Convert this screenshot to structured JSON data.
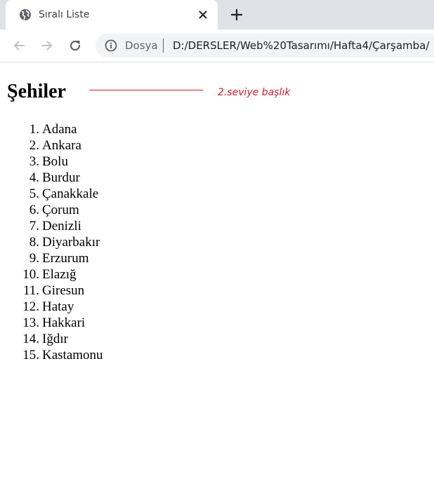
{
  "browser": {
    "tab": {
      "title": "Sıralı Liste",
      "favicon": "globe-icon",
      "close_icon": "close-icon"
    },
    "new_tab_icon": "plus-icon",
    "toolbar": {
      "back_icon": "arrow-left-icon",
      "forward_icon": "arrow-right-icon",
      "reload_icon": "reload-icon"
    },
    "omnibox": {
      "info_icon": "info-icon",
      "security_label": "Dosya",
      "url": "D:/DERSLER/Web%20Tasarımı/Hafta4/Çarşamba/"
    }
  },
  "page": {
    "heading": "Şehiler",
    "annotation": {
      "label": "2.seviye başlık",
      "color": "#cc1f2b"
    },
    "cities": [
      {
        "num": "1.",
        "name": "Adana"
      },
      {
        "num": "2.",
        "name": "Ankara"
      },
      {
        "num": "3.",
        "name": "Bolu"
      },
      {
        "num": "4.",
        "name": "Burdur"
      },
      {
        "num": "5.",
        "name": "Çanakkale"
      },
      {
        "num": "6.",
        "name": "Çorum"
      },
      {
        "num": "7.",
        "name": "Denizli"
      },
      {
        "num": "8.",
        "name": "Diyarbakır"
      },
      {
        "num": "9.",
        "name": "Erzurum"
      },
      {
        "num": "10.",
        "name": "Elazığ"
      },
      {
        "num": "11.",
        "name": "Giresun"
      },
      {
        "num": "12.",
        "name": "Hatay"
      },
      {
        "num": "13.",
        "name": "Hakkari"
      },
      {
        "num": "14.",
        "name": "Iğdır"
      },
      {
        "num": "15.",
        "name": "Kastamonu"
      }
    ]
  }
}
